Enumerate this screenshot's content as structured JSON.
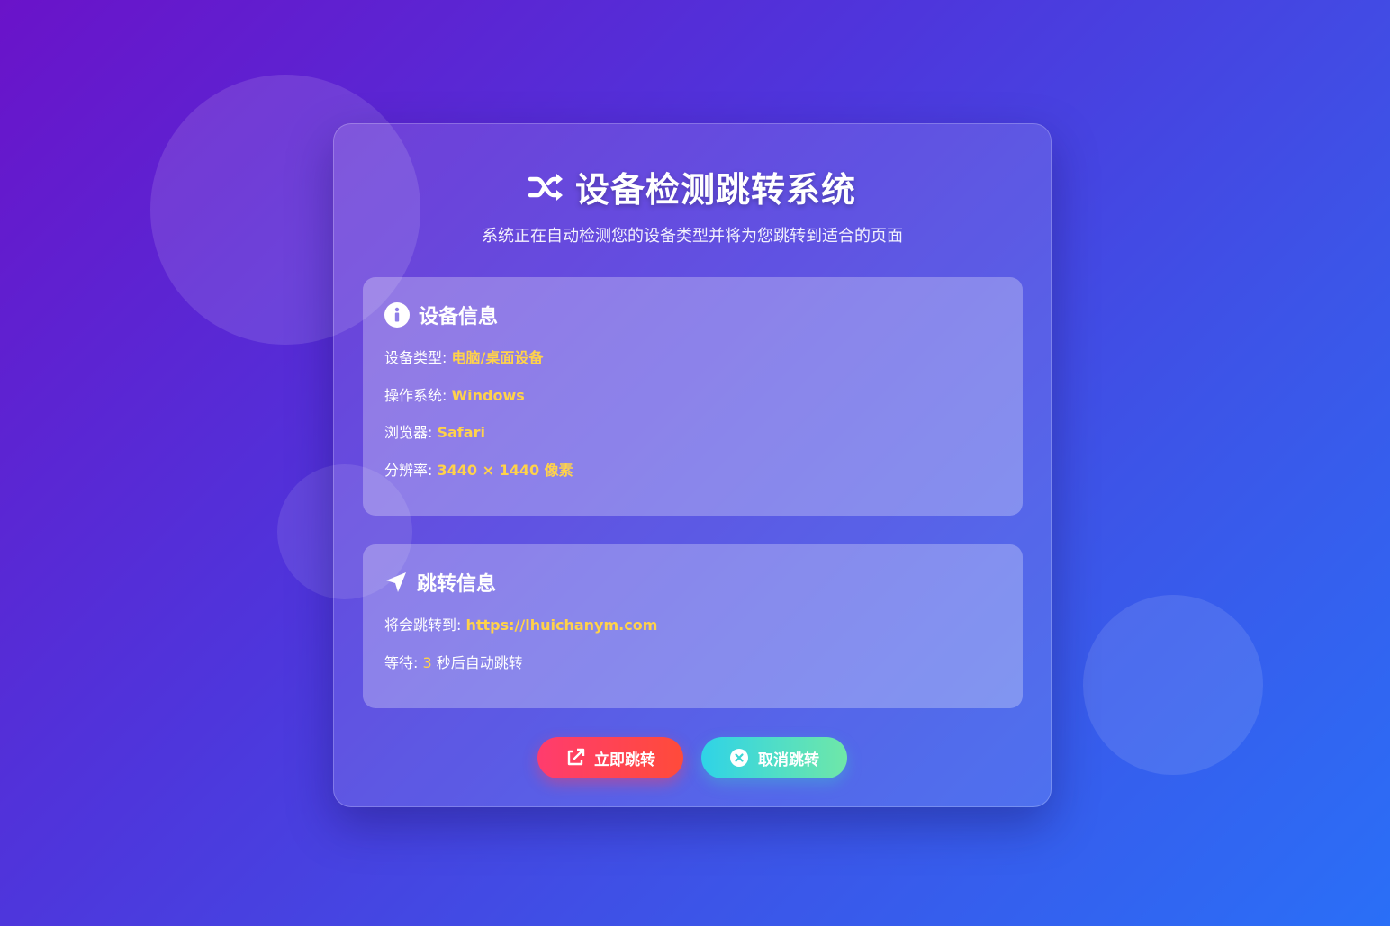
{
  "header": {
    "title": "设备检测跳转系统",
    "subtitle": "系统正在自动检测您的设备类型并将为您跳转到适合的页面",
    "icon": "shuffle-icon"
  },
  "device_panel": {
    "title": "设备信息",
    "icon": "info-icon",
    "rows": [
      {
        "label": "设备类型: ",
        "value": "电脑/桌面设备"
      },
      {
        "label": "操作系统: ",
        "value": "Windows"
      },
      {
        "label": "浏览器: ",
        "value": "Safari"
      },
      {
        "label": "分辨率: ",
        "value": "3440 × 1440 像素"
      }
    ]
  },
  "redirect_panel": {
    "title": "跳转信息",
    "icon": "location-arrow-icon",
    "target_label": "将会跳转到: ",
    "target_url": "https://lhuichanym.com",
    "wait_label": "等待: ",
    "wait_seconds": "3",
    "wait_suffix": " 秒后自动跳转"
  },
  "buttons": {
    "go_label": "立即跳转",
    "go_icon": "external-link-icon",
    "cancel_label": "取消跳转",
    "cancel_icon": "close-circle-icon"
  },
  "colors": {
    "accent_value": "#ffd24a",
    "go_button": "#ff3c6e",
    "cancel_button": "#2fd3e7"
  }
}
